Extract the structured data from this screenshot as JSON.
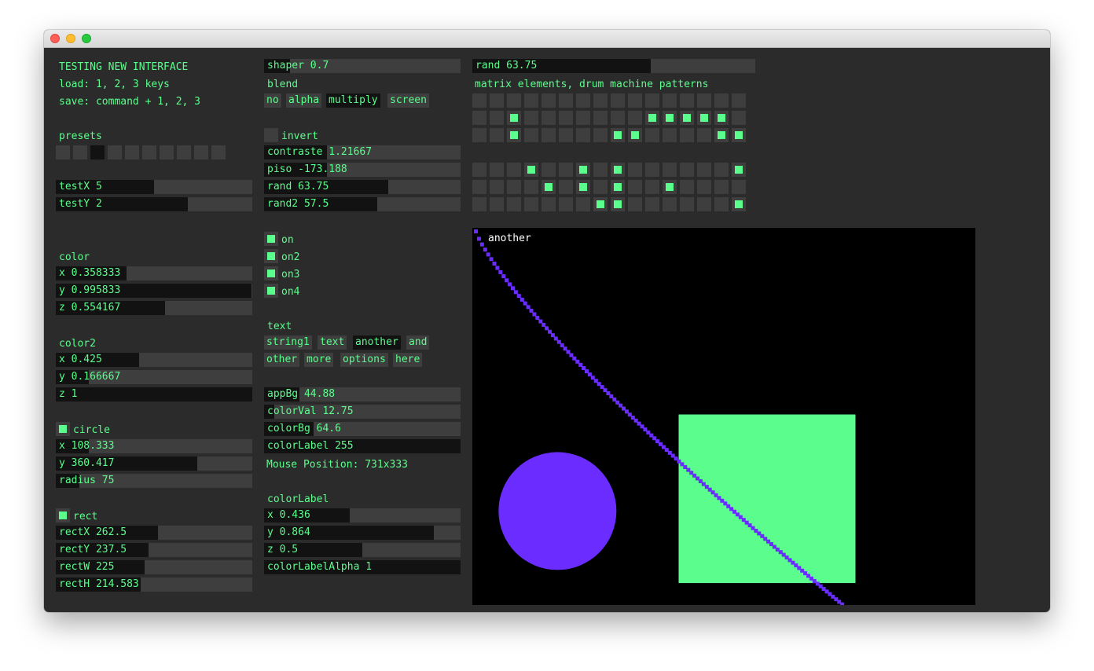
{
  "header": {
    "title": "TESTING NEW INTERFACE",
    "load_hint": "load: 1, 2, 3 keys",
    "save_hint": "save: command + 1, 2, 3"
  },
  "presets": {
    "label": "presets",
    "count": 10,
    "selected_index": 2
  },
  "test": {
    "testX": {
      "text": "testX 5",
      "fraction": 0.5
    },
    "testY": {
      "text": "testY 2",
      "fraction": 0.67
    }
  },
  "color": {
    "label": "color",
    "x": {
      "text": "x 0.358333",
      "fraction": 0.358333
    },
    "y": {
      "text": "y 0.995833",
      "fraction": 0.995833
    },
    "z": {
      "text": "z 0.554167",
      "fraction": 0.554167
    }
  },
  "color2": {
    "label": "color2",
    "x": {
      "text": "x 0.425",
      "fraction": 0.425
    },
    "y": {
      "text": "y 0.166667",
      "fraction": 0.166667
    },
    "z": {
      "text": "z 1",
      "fraction": 1
    }
  },
  "circle": {
    "label": "circle",
    "on": true,
    "x": {
      "text": "x 108.333",
      "fraction": 0.169
    },
    "y": {
      "text": "y 360.417",
      "fraction": 0.72
    },
    "radius": {
      "text": "radius 75",
      "fraction": 0.12
    }
  },
  "rect": {
    "label": "rect",
    "on": true,
    "rectX": {
      "text": "rectX 262.5",
      "fraction": 0.52
    },
    "rectY": {
      "text": "rectY 237.5",
      "fraction": 0.47
    },
    "rectW": {
      "text": "rectW 225",
      "fraction": 0.45
    },
    "rectH": {
      "text": "rectH 214.583",
      "fraction": 0.43
    }
  },
  "shaper": {
    "text": "shaper 0.7",
    "fraction": 0.13
  },
  "blend": {
    "label": "blend",
    "options": [
      "no",
      "alpha",
      "multiply",
      "screen"
    ],
    "selected": "multiply"
  },
  "invert": {
    "label": "invert",
    "on": false
  },
  "contraste": {
    "text": "contraste 1.21667",
    "fraction": 0.32
  },
  "piso": {
    "text": "piso -173.188",
    "fraction": 0.32
  },
  "rand": {
    "text": "rand 63.75",
    "fraction": 0.63
  },
  "rand2": {
    "text": "rand2 57.5",
    "fraction": 0.575
  },
  "toggles": [
    {
      "label": "on",
      "on": true
    },
    {
      "label": "on2",
      "on": true
    },
    {
      "label": "on3",
      "on": true
    },
    {
      "label": "on4",
      "on": true
    }
  ],
  "text_selector": {
    "label": "text",
    "options": [
      "string1",
      "text",
      "another",
      "and",
      "other",
      "more",
      "options",
      "here"
    ],
    "selected": "another"
  },
  "appBg": {
    "text": "appBg 44.88",
    "fraction": 0.18
  },
  "colorVal": {
    "text": "colorVal 12.75",
    "fraction": 0.05
  },
  "colorBg": {
    "text": "colorBg 64.6",
    "fraction": 0.25
  },
  "colorLabelSlider": {
    "text": "colorLabel 255",
    "fraction": 1
  },
  "mouse_position": "Mouse Position: 731x333",
  "colorLabel": {
    "label": "colorLabel",
    "x": {
      "text": "x 0.436",
      "fraction": 0.436
    },
    "y": {
      "text": "y 0.864",
      "fraction": 0.864
    },
    "z": {
      "text": "z 0.5",
      "fraction": 0.5
    },
    "alpha": {
      "text": "colorLabelAlpha 1",
      "fraction": 1
    }
  },
  "rand_top": {
    "text": "rand 63.75",
    "fraction": 0.63
  },
  "matrix": {
    "label": "matrix elements, drum machine patterns",
    "matrix1": [
      [
        0,
        0,
        0,
        0,
        0,
        0,
        0,
        0,
        0,
        0,
        0,
        0,
        0,
        0,
        0,
        0
      ],
      [
        0,
        0,
        1,
        0,
        0,
        0,
        0,
        0,
        0,
        0,
        1,
        1,
        1,
        1,
        1,
        0
      ],
      [
        0,
        0,
        1,
        0,
        0,
        0,
        0,
        0,
        1,
        1,
        0,
        0,
        0,
        0,
        1,
        1
      ]
    ],
    "matrix2": [
      [
        0,
        0,
        0,
        1,
        0,
        0,
        1,
        0,
        1,
        0,
        0,
        0,
        0,
        0,
        0,
        1
      ],
      [
        0,
        0,
        0,
        0,
        1,
        0,
        1,
        0,
        1,
        0,
        0,
        1,
        0,
        0,
        0,
        0
      ],
      [
        0,
        0,
        0,
        0,
        0,
        0,
        0,
        1,
        1,
        0,
        0,
        0,
        0,
        0,
        0,
        1
      ]
    ]
  },
  "canvas": {
    "label": "another",
    "colors": {
      "circle": "#6a2cff",
      "rect": "#5bfe8c",
      "line": "#6a2cff",
      "bg": "#000000"
    }
  },
  "colors": {
    "accent": "#5bfe8c",
    "panel": "#2b2b2b",
    "slider_bg": "#3e3e3e",
    "slider_fill": "#121212"
  }
}
